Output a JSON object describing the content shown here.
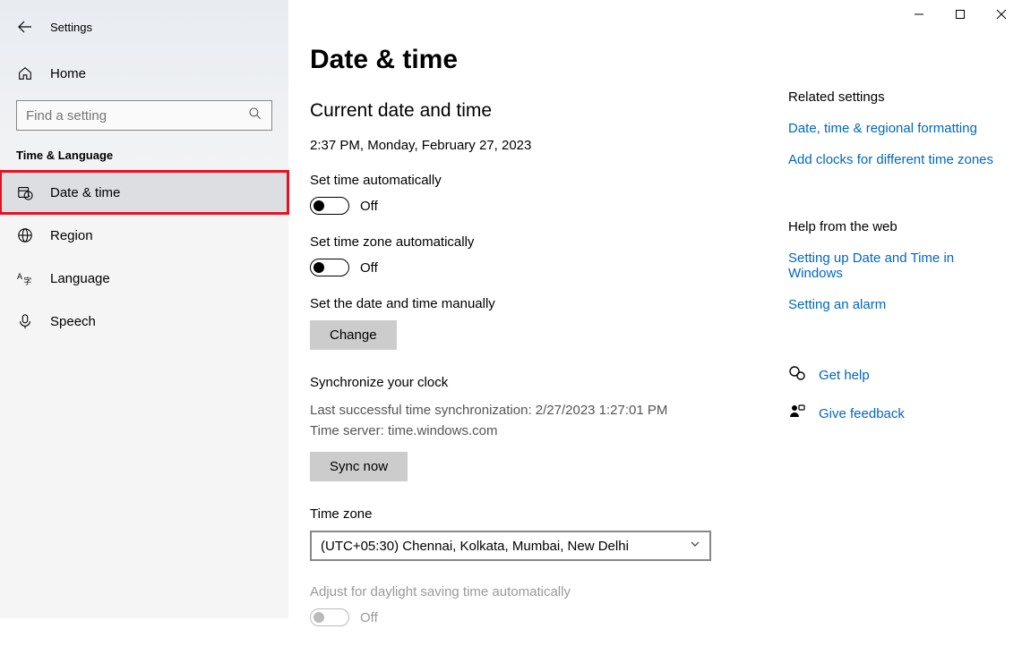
{
  "window": {
    "title": "Settings"
  },
  "sidebar": {
    "home": "Home",
    "search_placeholder": "Find a setting",
    "category": "Time & Language",
    "items": [
      {
        "label": "Date & time"
      },
      {
        "label": "Region"
      },
      {
        "label": "Language"
      },
      {
        "label": "Speech"
      }
    ]
  },
  "main": {
    "title": "Date & time",
    "current_section": "Current date and time",
    "current_value": "2:37 PM, Monday, February 27, 2023",
    "set_time_auto_label": "Set time automatically",
    "set_time_auto_state": "Off",
    "set_zone_auto_label": "Set time zone automatically",
    "set_zone_auto_state": "Off",
    "manual_label": "Set the date and time manually",
    "change_button": "Change",
    "sync_section": "Synchronize your clock",
    "sync_last": "Last successful time synchronization: 2/27/2023 1:27:01 PM",
    "sync_server": "Time server: time.windows.com",
    "sync_button": "Sync now",
    "tz_label": "Time zone",
    "tz_value": "(UTC+05:30) Chennai, Kolkata, Mumbai, New Delhi",
    "dst_label": "Adjust for daylight saving time automatically",
    "dst_state": "Off"
  },
  "right": {
    "related_head": "Related settings",
    "link_region": "Date, time & regional formatting",
    "link_clocks": "Add clocks for different time zones",
    "help_head": "Help from the web",
    "link_setup": "Setting up Date and Time in Windows",
    "link_alarm": "Setting an alarm",
    "get_help": "Get help",
    "feedback": "Give feedback"
  }
}
